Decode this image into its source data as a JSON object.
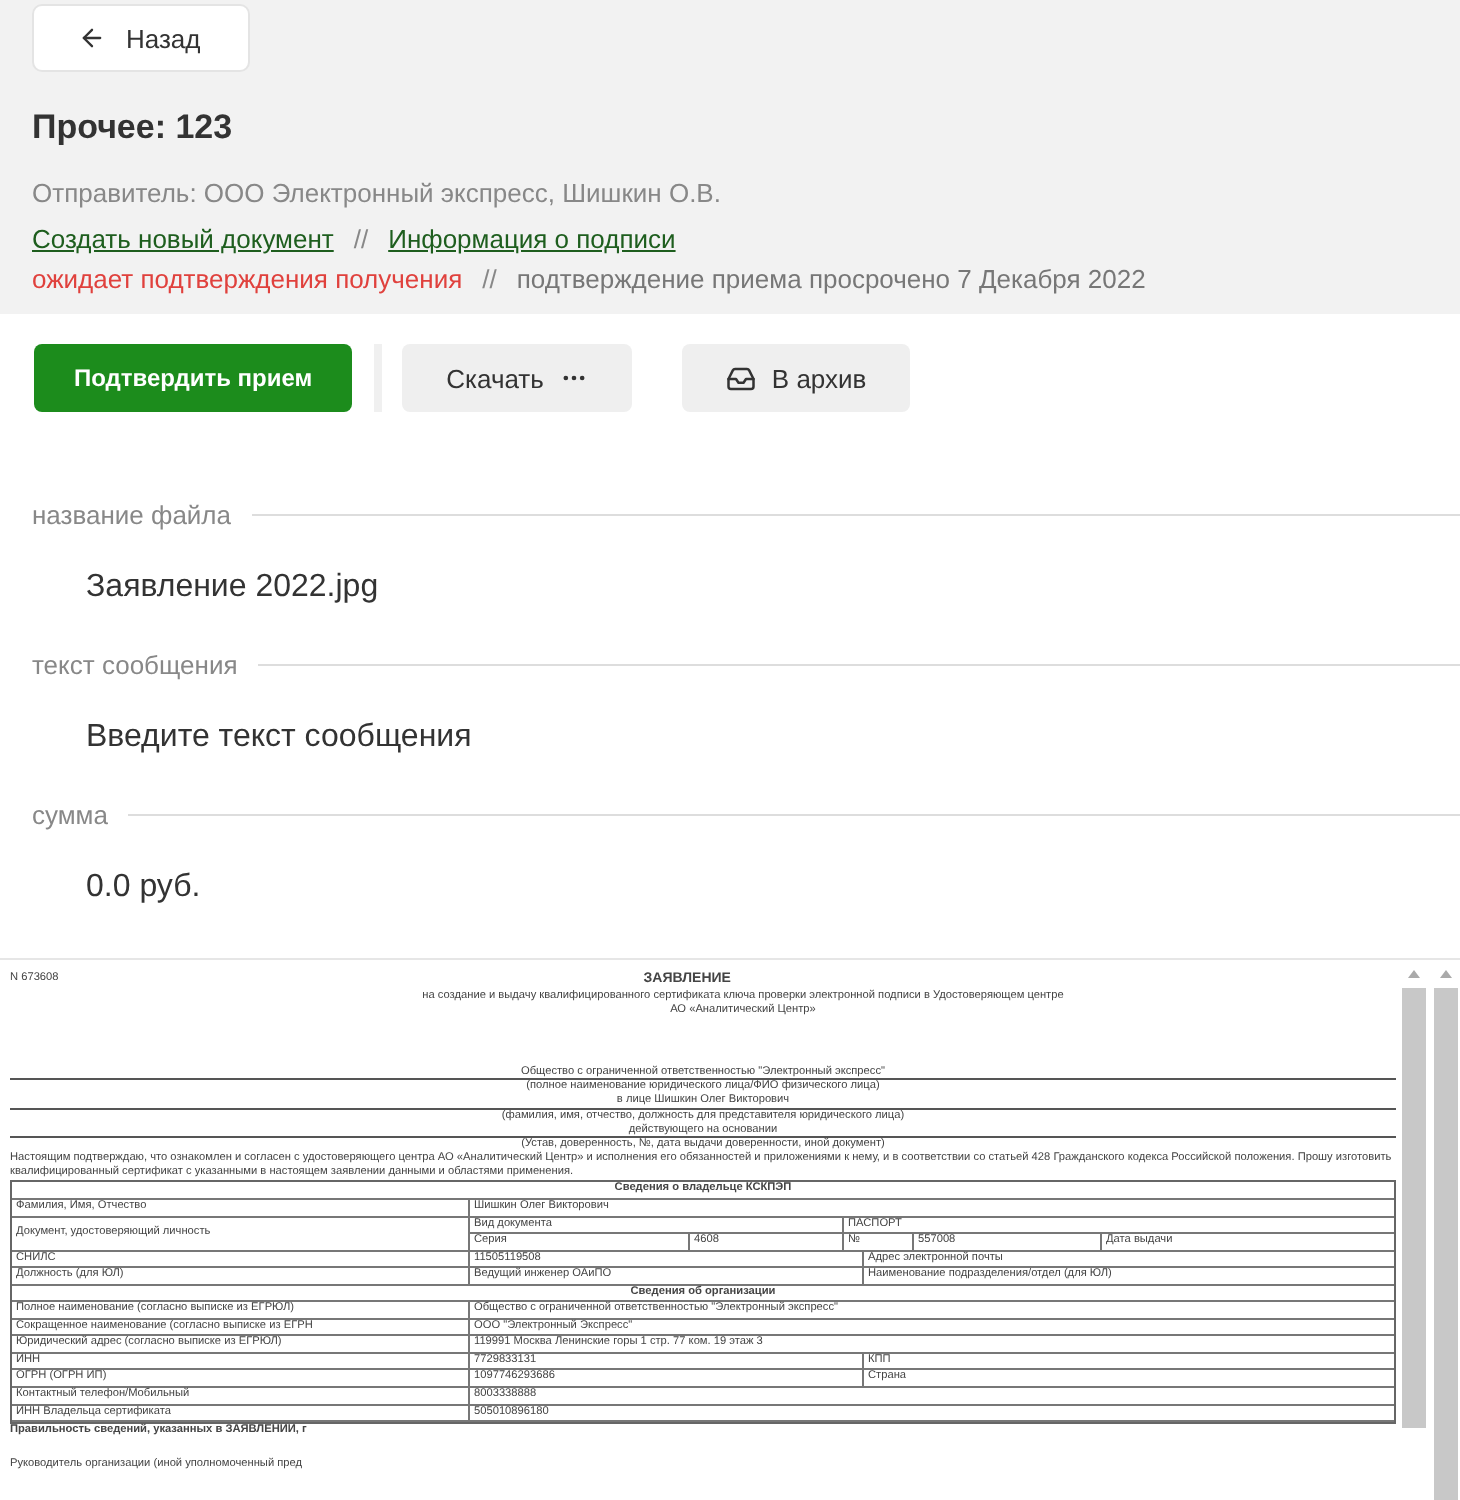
{
  "back_button": {
    "label": "Назад"
  },
  "header": {
    "title": "Прочее: 123",
    "sender": "Отправитель: ООО Электронный экспресс, Шишкин О.В.",
    "links": {
      "items": [
        "Создать новый документ",
        "Информация о подписи"
      ],
      "separator": "//"
    },
    "status": {
      "text": "ожидает подтверждения получения",
      "separator": "//",
      "note": "подтверждение приема просрочено 7 Декабря 2022"
    }
  },
  "actions": [
    {
      "kind": "primary",
      "label": "Подтвердить прием"
    },
    {
      "kind": "menu",
      "label": "Скачать"
    },
    {
      "kind": "archive",
      "label": "В архив"
    }
  ],
  "fields": [
    {
      "label": "название файла",
      "value": "Заявление 2022.jpg"
    },
    {
      "label": "текст сообщения",
      "value": "Введите текст сообщения"
    },
    {
      "label": "сумма",
      "value": "0.0 руб."
    }
  ],
  "document": {
    "number": "N 673608",
    "title": "ЗАЯВЛЕНИЕ",
    "subtitle": [
      "на создание и выдачу квалифицированного сертификата ключа проверки электронной подписи в Удостоверяющем центре",
      "АО «Аналитический Центр»"
    ],
    "lines": [
      {
        "kind": "value",
        "text": "Общество с ограниченной ответственностью \"Электронный экспресс\""
      },
      {
        "kind": "caption",
        "text": "(полное наименование юридического лица/ФИО физического лица)"
      },
      {
        "kind": "value",
        "text": "в лице Шишкин Олег Викторович"
      },
      {
        "kind": "caption",
        "text": "(фамилия, имя, отчество, должность для представителя юридического лица)"
      },
      {
        "kind": "value",
        "text": "действующего на основании"
      },
      {
        "kind": "caption",
        "text": "(Устав, доверенность, №, дата выдачи доверенности, иной документ)"
      }
    ],
    "paragraph": "Настоящим подтверждаю, что ознакомлен и согласен с удостоверяющего центра АО «Аналитический Центр» и исполнения его обязанностей и приложениями к нему, и в соответствии со статьей 428 Гражданского кодекса Российской положения. Прошу изготовить квалифицированный сертификат с указанными в настоящем заявлении данными и областями применения.",
    "rows": [
      {
        "kind": "header",
        "cells": [
          "Сведения о владельце КСКПЭП"
        ]
      },
      {
        "kind": "pair",
        "cells": [
          "Фамилия, Имя, Отчество",
          "Шишкин Олег Викторович"
        ]
      },
      {
        "kind": "id",
        "cells": [
          "Документ, удостоверяющий личность",
          "Вид документа",
          "ПАСПОРТ",
          "Серия",
          "4608",
          "№",
          "557008",
          "Дата выдачи"
        ]
      },
      {
        "kind": "triple",
        "cells": [
          "СНИЛС",
          "11505119508",
          "Адрес электронной почты"
        ]
      },
      {
        "kind": "triple",
        "cells": [
          "Должность (для ЮЛ)",
          "Ведущий инженер ОАиПО",
          "Наименование подразделения/отдел (для ЮЛ)"
        ]
      },
      {
        "kind": "header",
        "cells": [
          "Сведения об организации"
        ]
      },
      {
        "kind": "pair",
        "cells": [
          "Полное наименование (согласно выписке из ЕГРЮЛ)",
          "Общество с ограниченной ответственностью \"Электронный экспресс\""
        ]
      },
      {
        "kind": "pair",
        "cells": [
          "Сокращенное наименование (согласно выписке из ЕГРН",
          "ООО \"Электронный Экспресс\""
        ]
      },
      {
        "kind": "pair",
        "cells": [
          "Юридический адрес (согласно выписке из ЕГРЮЛ)",
          "119991 Москва Ленинские горы 1 стр. 77 ком. 19 этаж 3"
        ]
      },
      {
        "kind": "triple",
        "cells": [
          "ИНН",
          "7729833131",
          "КПП"
        ]
      },
      {
        "kind": "triple",
        "cells": [
          "ОГРН (ОГРН ИП)",
          "1097746293686",
          "Страна"
        ]
      },
      {
        "kind": "pair",
        "cells": [
          "Контактный телефон/Мобильный",
          "8003338888"
        ]
      },
      {
        "kind": "pair",
        "cells": [
          "ИНН Владельца сертификата",
          "505010896180"
        ]
      }
    ],
    "footer": [
      "Правильность сведений, указанных в ЗАЯВЛЕНИИ, г",
      "Руководитель организации (иной уполномоченный пред"
    ]
  }
}
